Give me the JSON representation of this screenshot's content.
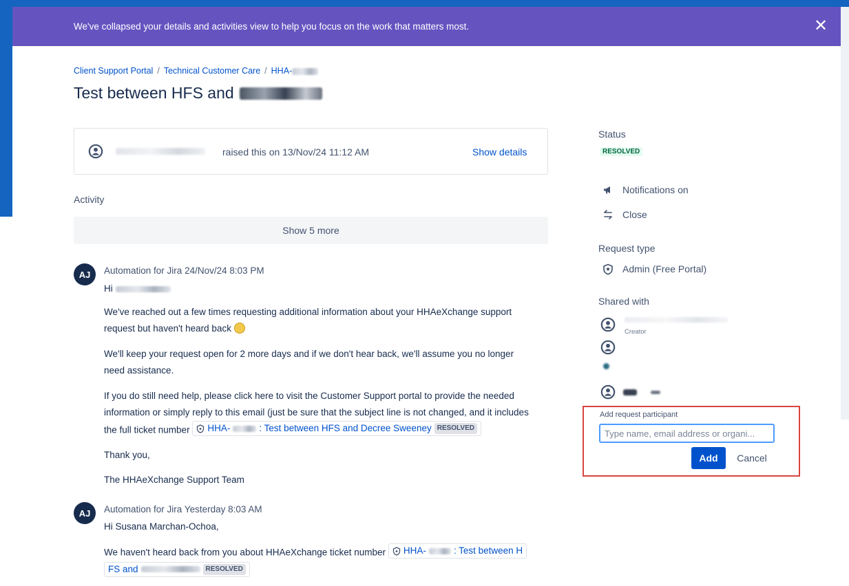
{
  "banner": {
    "message": "We've collapsed your details and activities view to help you focus on the work that matters most."
  },
  "breadcrumb": {
    "items": [
      "Client Support Portal",
      "Technical Customer Care",
      "HHA-"
    ],
    "separator": "/"
  },
  "request": {
    "title": "Test between HFS and",
    "raised_text": "raised this on 13/Nov/24 11:12 AM",
    "show_details_label": "Show details"
  },
  "activity": {
    "label": "Activity",
    "show_more_label": "Show 5 more",
    "messages": [
      {
        "avatar": "AJ",
        "author": "Automation for Jira",
        "time": "24/Nov/24 8:03 PM",
        "greeting": "Hi",
        "p1a": "We've reached out a few times requesting additional information about your HHAeXchange support",
        "p1b": "request but haven't heard back",
        "p2a": "We'll keep your request open for 2 more days and if we don't hear back, we'll assume you no longer",
        "p2b": "need assistance.",
        "p3a": "If you do still need help, please click here to visit the Customer Support portal to provide the needed",
        "p3b": "information or simply reply to this email (just be sure that the subject line is not changed, and it includes",
        "p3c": "the full ticket number",
        "chip_prefix": "HHA-",
        "chip_text": ": Test between HFS and Decree Sweeney",
        "chip_status": "RESOLVED",
        "thanks": "Thank you,",
        "signoff": "The HHAeXchange Support Team"
      },
      {
        "avatar": "AJ",
        "author": "Automation for Jira",
        "time": "Yesterday 8:03 AM",
        "greeting": "Hi Susana Marchan-Ochoa,",
        "p1a": "We haven't heard back from you about HHAeXchange ticket number",
        "chip_prefix": "HHA-",
        "chip_text": ": Test between H",
        "chip_cont": "FS and",
        "chip_status": "RESOLVED"
      }
    ]
  },
  "sidebar": {
    "status_label": "Status",
    "status_value": "RESOLVED",
    "notifications_label": "Notifications on",
    "close_label": "Close",
    "request_type_label": "Request type",
    "request_type_value": "Admin (Free Portal)",
    "shared_with_label": "Shared with",
    "creator_label": "Creator",
    "add_participant_label": "Add request participant",
    "participant_placeholder": "Type name, email address or organi...",
    "add_button": "Add",
    "cancel_button": "Cancel"
  },
  "colors": {
    "banner": "#6554c0",
    "link": "#0052cc",
    "primary_button": "#0052cc",
    "resolved_green_bg": "#e3fcef",
    "resolved_green_text": "#006644",
    "highlight_border": "#d9433f"
  },
  "icons": [
    "close-icon",
    "person-icon",
    "megaphone-icon",
    "transfer-icon",
    "shield-icon",
    "emoji-icon"
  ]
}
